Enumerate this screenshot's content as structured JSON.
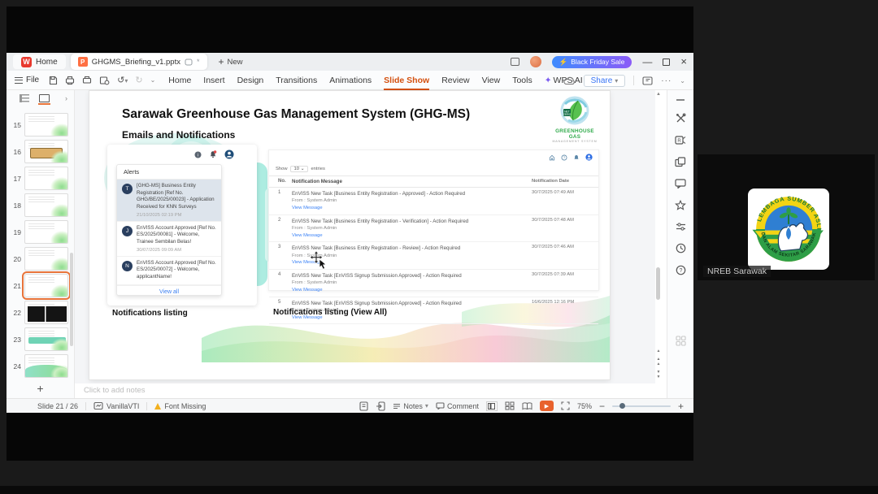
{
  "meeting": {
    "participant_label": "NREB Sarawak",
    "logo_top_text": "LEMBAGA SUMBER ASLI",
    "logo_bottom_text": "DAN ALAM SEKITAR SARAWAK"
  },
  "titlebar": {
    "home_tab": "Home",
    "doc_tab": "GHGMS_Briefing_v1.pptx",
    "doc_modified_mark": "*",
    "new_tab": "New",
    "promo_label": "Black Friday Sale"
  },
  "menubar": {
    "file_label": "File",
    "items": [
      "Home",
      "Insert",
      "Design",
      "Transitions",
      "Animations",
      "Slide Show",
      "Review",
      "View",
      "Tools",
      "WPS AI"
    ],
    "active": "Slide Show",
    "share_label": "Share"
  },
  "icons": {
    "wps_ai_sparkle": "✦",
    "lightning": "⚡"
  },
  "slide_panel": {
    "items": [
      {
        "n": "15",
        "variant": "plain"
      },
      {
        "n": "16",
        "variant": "tan"
      },
      {
        "n": "17",
        "variant": "plain"
      },
      {
        "n": "18",
        "variant": "plain"
      },
      {
        "n": "19",
        "variant": "plain"
      },
      {
        "n": "20",
        "variant": "plain"
      },
      {
        "n": "21",
        "variant": "plain"
      },
      {
        "n": "22",
        "variant": "dark"
      },
      {
        "n": "23",
        "variant": "teal"
      },
      {
        "n": "24",
        "variant": "wave"
      }
    ],
    "selected": "21"
  },
  "slide": {
    "title": "Sarawak Greenhouse Gas Management System (GHG-MS)",
    "subtitle": "Emails and Notifications",
    "logo_badge": "NET ZERO",
    "logo_name": "GREENHOUSE GAS",
    "logo_sub": "MANAGEMENT SYSTEM",
    "caption_left": "Notifications listing",
    "caption_right": "Notifications listing (View All)",
    "alerts": {
      "header": "Alerts",
      "view_all": "View all",
      "items": [
        {
          "initial": "T",
          "text": "[GHG-MS] Business Entity Registration [Ref No. GHG/BE/2025/00023] - Application Received for KNN Surveys",
          "time": "21/10/2025 02:19 PM",
          "highlight": true
        },
        {
          "initial": "J",
          "text": "EnVISS Account Approved [Ref No. ES/2025/00081] - Welcome, Trainee Sembilan Belas!",
          "time": "30/07/2025 09:09 AM",
          "highlight": false
        },
        {
          "initial": "N",
          "text": "EnVISS Account Approved [Ref No. ES/2025/00072] - Welcome, applicantName!",
          "time": "",
          "highlight": false
        }
      ]
    },
    "table": {
      "show_label": "Show",
      "show_value": "10",
      "entries_label": "entries",
      "col_no": "No.",
      "col_msg": "Notification Message",
      "col_date": "Notification Date",
      "rows": [
        {
          "no": "1",
          "message": "EnVISS New Task [Business Entity Registration - Approved] - Action Required",
          "from": "From : System Admin",
          "link": "View Message",
          "date": "30/7/2025 07:49 AM"
        },
        {
          "no": "2",
          "message": "EnVISS New Task [Business Entity Registration - Verification] - Action Required",
          "from": "From : System Admin",
          "link": "View Message",
          "date": "30/7/2025 07:48 AM"
        },
        {
          "no": "3",
          "message": "EnVISS New Task [Business Entity Registration - Review] - Action Required",
          "from": "From : System Admin",
          "link": "View Message",
          "date": "30/7/2025 07:46 AM"
        },
        {
          "no": "4",
          "message": "EnVISS New Task [EnVISS Signup Submission Approved] - Action Required",
          "from": "From : System Admin",
          "link": "View Message",
          "date": "30/7/2025 07:39 AM"
        },
        {
          "no": "5",
          "message": "EnVISS New Task [EnVISS Signup Submission Approved] - Action Required",
          "from": "From : System Admin",
          "link": "View Message",
          "date": "16/6/2025 12:16 PM"
        }
      ]
    }
  },
  "notes": {
    "placeholder": "Click to add notes"
  },
  "statusbar": {
    "slide_indicator": "Slide 21 / 26",
    "theme_name": "VanillaVTI",
    "font_missing": "Font Missing",
    "notes_label": "Notes",
    "comment_label": "Comment",
    "zoom_value": "75%"
  },
  "colors": {
    "accent_orange": "#d4500f",
    "promo_gradient": [
      "#3f8cfe",
      "#8b5bf7"
    ],
    "link_blue": "#3b82f6",
    "teal_deco": "#a9ebdf"
  }
}
